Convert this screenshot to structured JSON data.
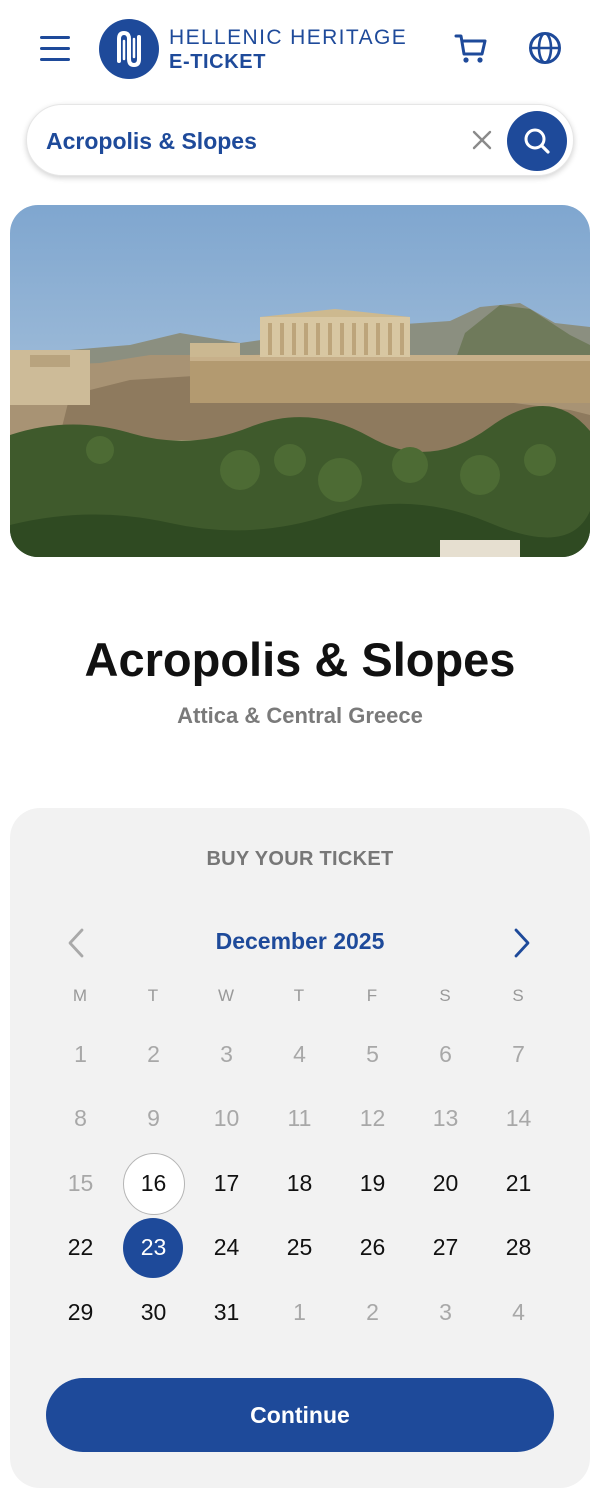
{
  "header": {
    "logo_line1": "HELLENIC HERITAGE",
    "logo_line2": "E-TICKET",
    "icons": [
      "menu-icon",
      "logo-mark-icon",
      "cart-icon",
      "globe-icon"
    ]
  },
  "search": {
    "value": "Acropolis & Slopes",
    "clear_icon": "close-icon",
    "search_icon": "search-icon"
  },
  "site": {
    "title": "Acropolis & Slopes",
    "region": "Attica & Central Greece"
  },
  "ticket": {
    "heading": "BUY YOUR TICKET",
    "month": "December 2025",
    "prev_icon": "chevron-left-icon",
    "next_icon": "chevron-right-icon",
    "weekdays": [
      "M",
      "T",
      "W",
      "T",
      "F",
      "S",
      "S"
    ],
    "weeks": [
      [
        {
          "d": "1",
          "s": "muted"
        },
        {
          "d": "2",
          "s": "muted"
        },
        {
          "d": "3",
          "s": "muted"
        },
        {
          "d": "4",
          "s": "muted"
        },
        {
          "d": "5",
          "s": "muted"
        },
        {
          "d": "6",
          "s": "muted"
        },
        {
          "d": "7",
          "s": "muted"
        }
      ],
      [
        {
          "d": "8",
          "s": "muted"
        },
        {
          "d": "9",
          "s": "muted"
        },
        {
          "d": "10",
          "s": "muted"
        },
        {
          "d": "11",
          "s": "muted"
        },
        {
          "d": "12",
          "s": "muted"
        },
        {
          "d": "13",
          "s": "muted"
        },
        {
          "d": "14",
          "s": "muted"
        }
      ],
      [
        {
          "d": "15",
          "s": "muted"
        },
        {
          "d": "16",
          "s": "today"
        },
        {
          "d": "17",
          "s": "avail"
        },
        {
          "d": "18",
          "s": "avail"
        },
        {
          "d": "19",
          "s": "avail"
        },
        {
          "d": "20",
          "s": "avail"
        },
        {
          "d": "21",
          "s": "avail"
        }
      ],
      [
        {
          "d": "22",
          "s": "avail"
        },
        {
          "d": "23",
          "s": "selected"
        },
        {
          "d": "24",
          "s": "avail"
        },
        {
          "d": "25",
          "s": "avail"
        },
        {
          "d": "26",
          "s": "avail"
        },
        {
          "d": "27",
          "s": "avail"
        },
        {
          "d": "28",
          "s": "avail"
        }
      ],
      [
        {
          "d": "29",
          "s": "avail"
        },
        {
          "d": "30",
          "s": "avail"
        },
        {
          "d": "31",
          "s": "avail"
        },
        {
          "d": "1",
          "s": "muted"
        },
        {
          "d": "2",
          "s": "muted"
        },
        {
          "d": "3",
          "s": "muted"
        },
        {
          "d": "4",
          "s": "muted"
        }
      ]
    ],
    "continue_label": "Continue"
  },
  "colors": {
    "brand": "#1e4a9a",
    "card_bg": "#f2f2f2",
    "muted_text": "#a8a8a8"
  }
}
